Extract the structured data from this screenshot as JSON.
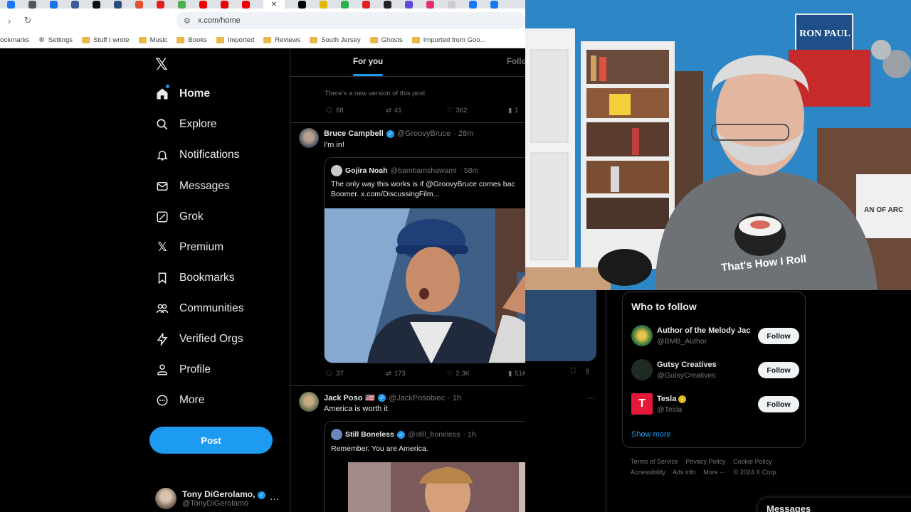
{
  "browser": {
    "url": "x.com/home",
    "bookmarks": [
      "ookmarks",
      "Settings",
      "Stuff I wrote",
      "Music",
      "Books",
      "Imported",
      "Reviews",
      "South Jersey",
      "Ghosts",
      "Imported from Goo..."
    ]
  },
  "nav": {
    "items": [
      {
        "label": "Home",
        "icon": "home-icon"
      },
      {
        "label": "Explore",
        "icon": "search-icon"
      },
      {
        "label": "Notifications",
        "icon": "bell-icon"
      },
      {
        "label": "Messages",
        "icon": "mail-icon"
      },
      {
        "label": "Grok",
        "icon": "grok-icon"
      },
      {
        "label": "Premium",
        "icon": "x-icon"
      },
      {
        "label": "Bookmarks",
        "icon": "bookmark-icon"
      },
      {
        "label": "Communities",
        "icon": "people-icon"
      },
      {
        "label": "Verified Orgs",
        "icon": "bolt-icon"
      },
      {
        "label": "Profile",
        "icon": "person-icon"
      },
      {
        "label": "More",
        "icon": "more-circle-icon"
      }
    ],
    "post_label": "Post",
    "account": {
      "name": "Tony DiGerolamo,",
      "handle": "@TonyDiGerolamo"
    }
  },
  "feed": {
    "tabs": {
      "for_you": "For you",
      "following": "Follo"
    },
    "prev_tweet": {
      "notice": "There's a new version of this post",
      "replies": "68",
      "reposts": "41",
      "likes": "362",
      "views": "1"
    },
    "tweet1": {
      "name": "Bruce Campbell",
      "handle": "@GroovyBruce",
      "time": "· 28m",
      "text": "I'm in!",
      "quote": {
        "name": "Gojira Noah",
        "handle": "@bambamshawaml",
        "time": "· 58m",
        "line1": "The only way this works is if @GroovyBruce comes bac",
        "line2": "Boomer.  x.com/DiscussingFilm..."
      },
      "replies": "37",
      "reposts": "173",
      "likes": "2.3K",
      "views": "51K"
    },
    "tweet2": {
      "name": "Jack Poso",
      "flag": "🇺🇸",
      "handle": "@JackPosobiec",
      "time": "· 1h",
      "text": "America is worth it",
      "quote": {
        "name": "Still Boneless",
        "handle": "@still_boneless",
        "time": "· 1h",
        "text": "Remember. You are America."
      }
    }
  },
  "who_to_follow": {
    "title": "Who to follow",
    "accounts": [
      {
        "name": "Author of the Melody Jac",
        "handle": "@BMB_Author",
        "button": "Follow"
      },
      {
        "name": "Gutsy Creatives",
        "handle": "@GutsyCreatives",
        "button": "Follow"
      },
      {
        "name": "Tesla",
        "handle": "@Tesla",
        "button": "Follow"
      }
    ],
    "show_more": "Show more"
  },
  "footer": {
    "links": [
      "Terms of Service",
      "Privacy Policy",
      "Cookie Policy",
      "Accessibility",
      "Ads info",
      "More ···",
      "© 2024 X Corp."
    ]
  },
  "webcam": {
    "poster_text": "RON PAUL",
    "shirt_text": "That's How I Roll",
    "sign_text": "AN OF ARC"
  },
  "messages_drawer": {
    "title": "Messages"
  }
}
